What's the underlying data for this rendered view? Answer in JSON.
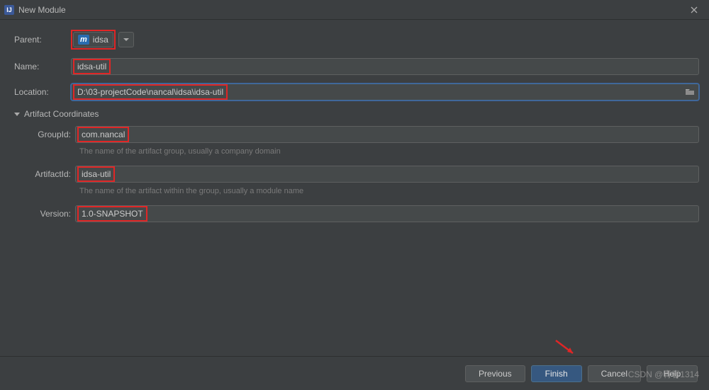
{
  "window": {
    "title": "New Module"
  },
  "fields": {
    "parent": {
      "label": "Parent:",
      "badge": "m",
      "value": "idsa"
    },
    "name": {
      "label": "Name:",
      "value": "idsa-util"
    },
    "location": {
      "label": "Location:",
      "value": "D:\\03-projectCode\\nancal\\idsa\\idsa-util",
      "highlight_text": "D:\\03-projectCode\\nancal\\idsa\\idsa-util"
    }
  },
  "artifact": {
    "section_title": "Artifact Coordinates",
    "group_id": {
      "label": "GroupId:",
      "value": "com.nancal",
      "hint": "The name of the artifact group, usually a company domain"
    },
    "artifact_id": {
      "label": "ArtifactId:",
      "value": "idsa-util",
      "hint": "The name of the artifact within the group, usually a module name"
    },
    "version": {
      "label": "Version:",
      "value": "1.0-SNAPSHOT"
    }
  },
  "footer": {
    "previous": "Previous",
    "finish": "Finish",
    "cancel": "Cancel",
    "help": "Help"
  },
  "watermark": "CSDN @青春1314"
}
